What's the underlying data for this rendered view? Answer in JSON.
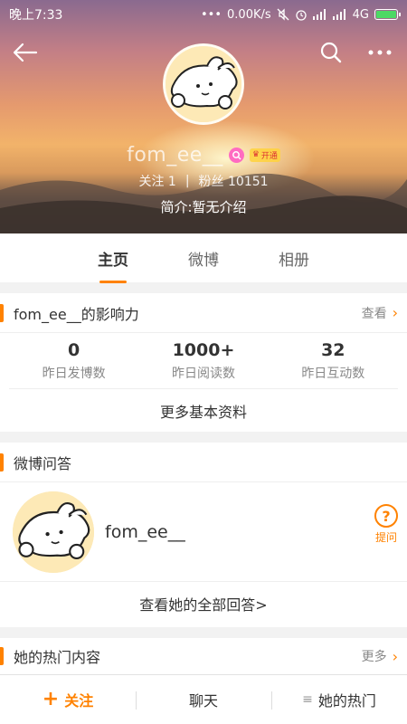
{
  "status_bar": {
    "time": "晚上7:33",
    "network_speed": "0.00K/s",
    "network_type": "4G"
  },
  "profile": {
    "username": "fom_ee__",
    "vip_badge": "开通",
    "following_label": "关注",
    "following_count": "1",
    "separator": "|",
    "fans_label": "粉丝",
    "fans_count": "10151",
    "bio": "简介:暂无介绍"
  },
  "tabs": [
    {
      "label": "主页",
      "active": true
    },
    {
      "label": "微博",
      "active": false
    },
    {
      "label": "相册",
      "active": false
    }
  ],
  "influence": {
    "title": "fom_ee__的影响力",
    "link": "查看",
    "stats": [
      {
        "value": "0",
        "label": "昨日发博数"
      },
      {
        "value": "1000+",
        "label": "昨日阅读数"
      },
      {
        "value": "32",
        "label": "昨日互动数"
      }
    ],
    "more": "更多基本资料"
  },
  "qa": {
    "title": "微博问答",
    "username": "fom_ee__",
    "ask_label": "提问",
    "view_all": "查看她的全部回答>"
  },
  "hot": {
    "title": "她的热门内容",
    "link": "更多"
  },
  "bottom_bar": {
    "follow": "关注",
    "chat": "聊天",
    "hot": "她的热门"
  },
  "colors": {
    "accent": "#ff8200",
    "background": "#f2f2f2"
  }
}
